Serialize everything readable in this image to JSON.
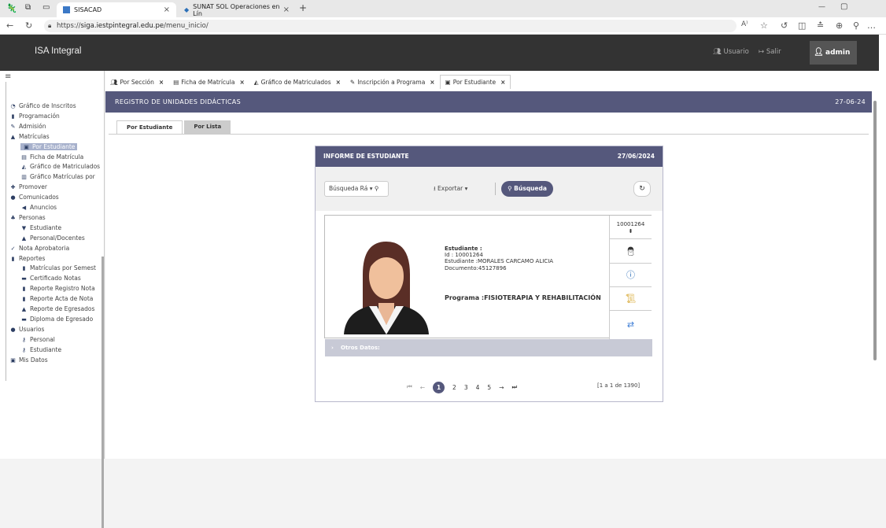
{
  "browser": {
    "tabs": [
      {
        "title": "SISACAD",
        "close": "×"
      },
      {
        "title": "SUNAT SOL Operaciones en Lín",
        "close": "×"
      }
    ],
    "new_tab": "+",
    "url_prefix": "https://",
    "url_host": "siga.iestpintegral.edu.pe",
    "url_path": "/menu_inicio/",
    "win_min": "—",
    "win_max": "▢"
  },
  "header": {
    "brand": "ISA Integral",
    "usuario": "Usuario",
    "salir": "Salir",
    "admin": "admin"
  },
  "sidebar": {
    "items": [
      {
        "label": "Gráfico de Inscritos",
        "icon": "pie-chart-icon"
      },
      {
        "label": "Programación",
        "icon": "book-icon"
      },
      {
        "label": "Admisión",
        "icon": "edit-icon"
      },
      {
        "label": "Matrículas",
        "icon": "graduation-icon"
      },
      {
        "label": "Por Estudiante",
        "icon": "id-card-icon"
      },
      {
        "label": "Ficha de Matrícula",
        "icon": "form-icon"
      },
      {
        "label": "Gráfico de Matriculados",
        "icon": "area-chart-icon"
      },
      {
        "label": "Gráfico Matrículas por",
        "icon": "bar-chart-icon"
      },
      {
        "label": "Promover",
        "icon": "user-plus-icon"
      },
      {
        "label": "Comunicados",
        "icon": "users-icon"
      },
      {
        "label": "Anuncios",
        "icon": "bullhorn-icon"
      },
      {
        "label": "Personas",
        "icon": "people-icon"
      },
      {
        "label": "Estudiante",
        "icon": "student-icon"
      },
      {
        "label": "Personal/Docentes",
        "icon": "user-icon"
      },
      {
        "label": "Nota Aprobatoria",
        "icon": "check-icon"
      },
      {
        "label": "Reportes",
        "icon": "report-icon"
      },
      {
        "label": "Matrículas por Semest",
        "icon": "book-icon"
      },
      {
        "label": "Certificado Notas",
        "icon": "certificate-icon"
      },
      {
        "label": "Reporte Registro Nota",
        "icon": "report-icon"
      },
      {
        "label": "Reporte Acta de Nota",
        "icon": "book-icon"
      },
      {
        "label": "Reporte de Egresados",
        "icon": "graduation-icon"
      },
      {
        "label": "Diploma de Egresado",
        "icon": "diploma-icon"
      },
      {
        "label": "Usuarios",
        "icon": "users-icon"
      },
      {
        "label": "Personal",
        "icon": "key-icon"
      },
      {
        "label": "Estudiante",
        "icon": "key-icon"
      },
      {
        "label": "Mis Datos",
        "icon": "id-card-icon"
      }
    ]
  },
  "page_tabs": [
    {
      "label": "Por Sección"
    },
    {
      "label": "Ficha de Matrícula"
    },
    {
      "label": "Gráfico de Matriculados"
    },
    {
      "label": "Inscripción a Programa"
    },
    {
      "label": "Por Estudiante"
    }
  ],
  "banner": {
    "title": "REGISTRO DE UNIDADES DIDÁCTICAS",
    "date": "27-06-24"
  },
  "subtabs": [
    "Por Estudiante",
    "Por Lista"
  ],
  "report": {
    "title": "INFORME DE ESTUDIANTE",
    "date": "27/06/2024",
    "quick_search": "Búsqueda Rá",
    "export": "Exportar",
    "search_button": "Búsqueda",
    "student_label": "Estudiante :",
    "id_line": "Id : 10001264",
    "name_line": "Estudiante :MORALES CARCAMO ALICIA",
    "doc_line": "Documento:45127896",
    "program": "Programa :FISIOTERAPIA Y REHABILITACIÓN",
    "code": "10001264",
    "otros": "Otros Datos:",
    "pages": [
      "1",
      "2",
      "3",
      "4",
      "5"
    ],
    "range": "[1 a 1 de 1390]"
  },
  "colors": {
    "accent": "#55587c",
    "header_bg": "#333333",
    "selected": "#a7b1cc"
  }
}
